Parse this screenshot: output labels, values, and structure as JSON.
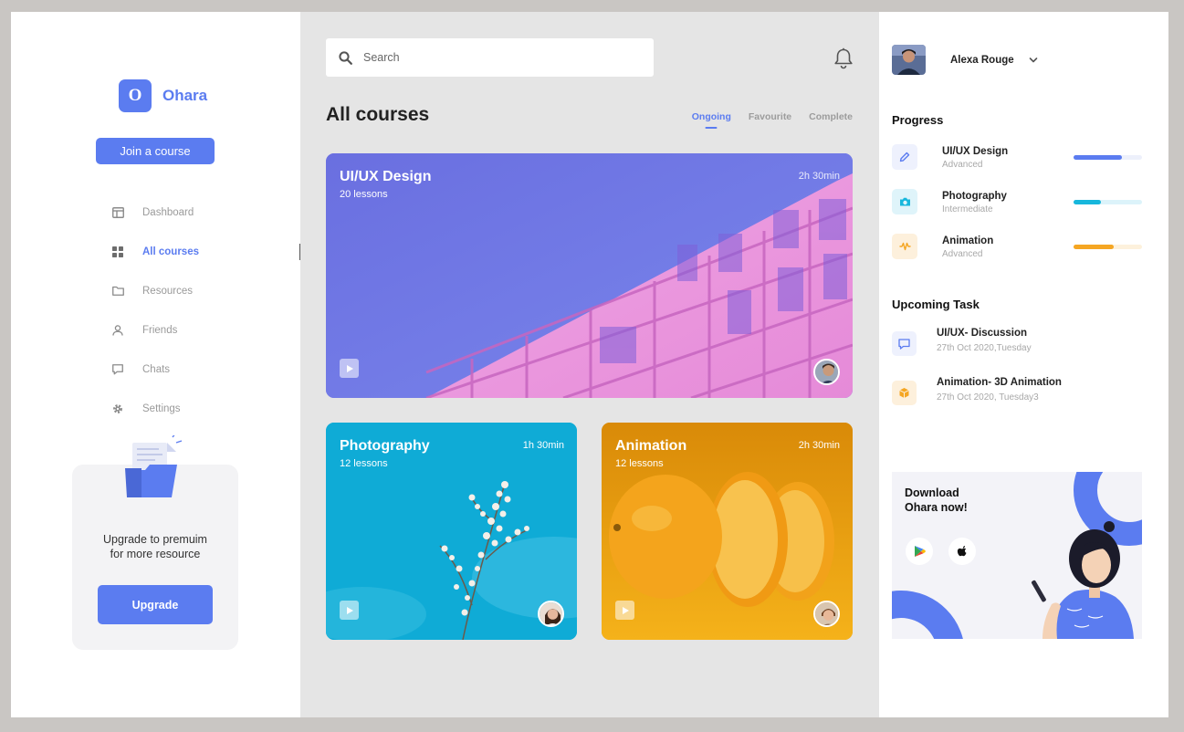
{
  "brand": {
    "logo_letter": "O",
    "name": "Ohara"
  },
  "sidebar": {
    "join_label": "Join a course",
    "items": [
      {
        "label": "Dashboard",
        "icon": "dashboard-icon"
      },
      {
        "label": "All courses",
        "icon": "grid-icon",
        "active": true
      },
      {
        "label": "Resources",
        "icon": "folder-icon"
      },
      {
        "label": "Friends",
        "icon": "user-icon"
      },
      {
        "label": "Chats",
        "icon": "chat-icon"
      },
      {
        "label": "Settings",
        "icon": "gear-icon"
      }
    ],
    "upgrade": {
      "line1": "Upgrade to premuim",
      "line2": "for more resource",
      "button": "Upgrade"
    }
  },
  "main": {
    "search_placeholder": "Search",
    "title": "All courses",
    "tabs": [
      {
        "label": "Ongoing",
        "active": true
      },
      {
        "label": "Favourite"
      },
      {
        "label": "Complete"
      }
    ],
    "courses": [
      {
        "title": "UI/UX Design",
        "lessons": "20 lessons",
        "time": "2h 30min",
        "color": "#6d78e6"
      },
      {
        "title": "Photography",
        "lessons": "12 lessons",
        "time": "1h 30min",
        "color": "#10acd6"
      },
      {
        "title": "Animation",
        "lessons": "12 lessons",
        "time": "2h 30min",
        "color": "#e99a10"
      }
    ]
  },
  "right": {
    "user_name": "Alexa Rouge",
    "progress_title": "Progress",
    "progress": [
      {
        "name": "UI/UX Design",
        "level": "Advanced",
        "percent": 70,
        "color": "#5b7cf0",
        "track": "#edf0fb",
        "icon": "pencil-icon"
      },
      {
        "name": "Photography",
        "level": "Intermediate",
        "percent": 40,
        "color": "#17b7dc",
        "track": "#dcf3fa",
        "icon": "camera-icon"
      },
      {
        "name": "Animation",
        "level": "Advanced",
        "percent": 58,
        "color": "#f5a623",
        "track": "#fdf1dc",
        "icon": "wave-icon"
      }
    ],
    "tasks_title": "Upcoming Task",
    "tasks": [
      {
        "name": "UI/UX- Discussion",
        "date": "27th Oct 2020,Tuesday",
        "icon": "chat-bubble-icon"
      },
      {
        "name": "Animation- 3D Animation",
        "date": "27th Oct 2020, Tuesday3",
        "icon": "cube-icon"
      }
    ],
    "download": {
      "line1": "Download",
      "line2": "Ohara now!"
    }
  },
  "colors": {
    "accent": "#5b7cf0",
    "page_bg": "#e5e5e5"
  }
}
